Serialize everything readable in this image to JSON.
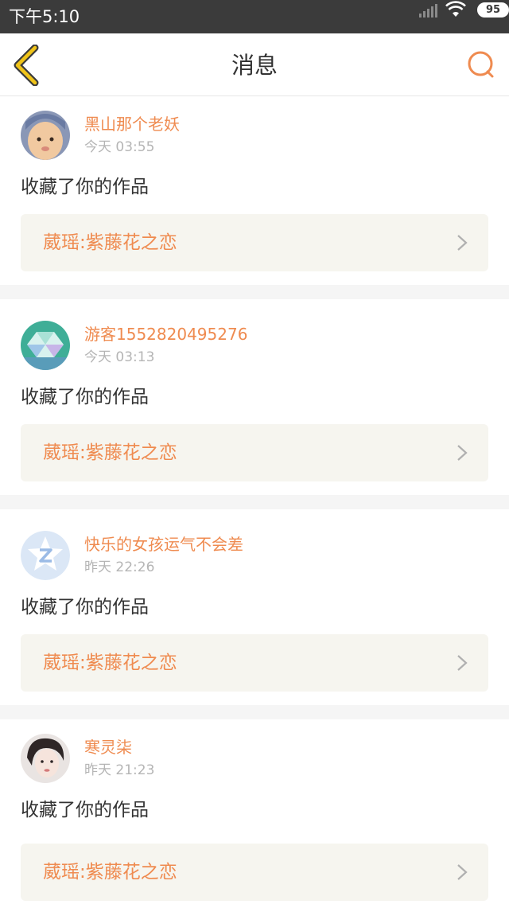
{
  "status_bar": {
    "time": "下午5:10",
    "battery": "95"
  },
  "header": {
    "title": "消息",
    "accent_color": "#ef8b50",
    "back_icon_color": "#f0c419"
  },
  "messages": [
    {
      "username": "黑山那个老妖",
      "time": "今天 03:55",
      "action": "收藏了你的作品",
      "work_title": "葳瑶:紫藤花之恋"
    },
    {
      "username": "游客1552820495276",
      "time": "今天 03:13",
      "action": "收藏了你的作品",
      "work_title": "葳瑶:紫藤花之恋"
    },
    {
      "username": "快乐的女孩运气不会差",
      "time": "昨天 22:26",
      "action": "收藏了你的作品",
      "work_title": "葳瑶:紫藤花之恋"
    },
    {
      "username": "寒灵柒",
      "time": "昨天 21:23",
      "action": "收藏了你的作品",
      "work_title": "葳瑶:紫藤花之恋"
    }
  ]
}
